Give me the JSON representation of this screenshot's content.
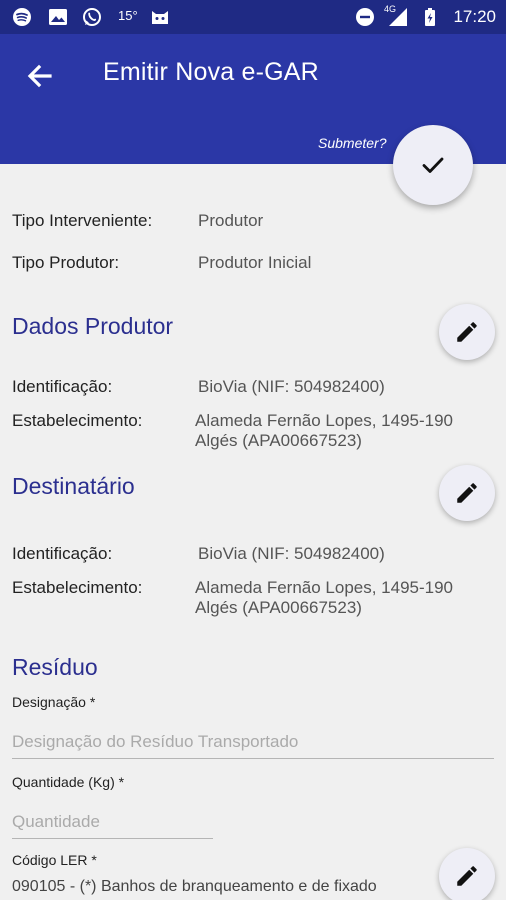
{
  "status_bar": {
    "temperature": "15°",
    "network": "4G",
    "time": "17:20",
    "icons": [
      "spotify-icon",
      "gallery-icon",
      "whatsapp-icon",
      "cat-icon",
      "do-not-disturb-icon",
      "signal-icon",
      "battery-icon"
    ]
  },
  "app_bar": {
    "title": "Emitir Nova e-GAR",
    "submit_hint": "Submeter?"
  },
  "intervener": {
    "type_label": "Tipo Interveniente:",
    "type_value": "Produtor",
    "producer_type_label": "Tipo Produtor:",
    "producer_type_value": "Produtor Inicial"
  },
  "producer": {
    "title": "Dados Produtor",
    "id_label": "Identificação:",
    "id_value": "BioVia (NIF: 504982400)",
    "estab_label": "Estabelecimento:",
    "estab_line1": "Alameda Fernão Lopes, 1495-190",
    "estab_line2": "Algés (APA00667523)"
  },
  "recipient": {
    "title": "Destinatário",
    "id_label": "Identificação:",
    "id_value": "BioVia (NIF: 504982400)",
    "estab_label": "Estabelecimento:",
    "estab_line1": "Alameda Fernão Lopes, 1495-190",
    "estab_line2": "Algés (APA00667523)"
  },
  "residue": {
    "title": "Resíduo",
    "designation_label": "Designação *",
    "designation_placeholder": "Designação do Resíduo Transportado",
    "quantity_label": "Quantidade (Kg) *",
    "quantity_placeholder": "Quantidade",
    "ler_label": "Código LER *",
    "ler_value": "090105 - (*) Banhos de branqueamento e de fixado"
  },
  "colors": {
    "status_bar": "#1f2a84",
    "app_bar": "#2b37a6",
    "section_title": "#2b2f8f",
    "background": "#f0f0f0",
    "fab": "#eeeef6"
  }
}
